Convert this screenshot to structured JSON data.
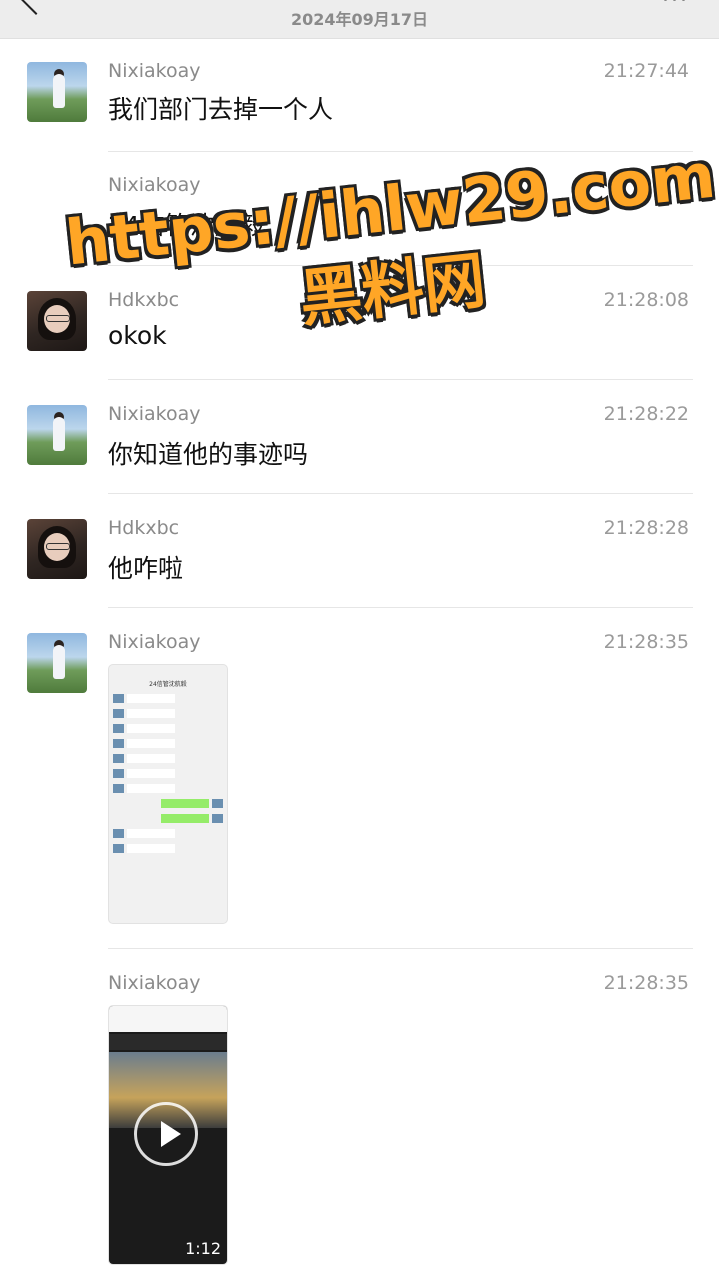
{
  "header": {
    "date": "2024年09月17日"
  },
  "messages": [
    {
      "sender": "Nixiakoay",
      "time": "21:27:44",
      "text": "我们部门去掉一个人"
    },
    {
      "sender": "Nixiakoay",
      "time": "",
      "text": "24信管沈航毅"
    },
    {
      "sender": "Hdkxbc",
      "time": "21:28:08",
      "text": "okok"
    },
    {
      "sender": "Nixiakoay",
      "time": "21:28:22",
      "text": "你知道他的事迹吗"
    },
    {
      "sender": "Hdkxbc",
      "time": "21:28:28",
      "text": "他咋啦"
    },
    {
      "sender": "Nixiakoay",
      "time": "21:28:35",
      "image_title": "24信管沈航毅"
    },
    {
      "sender": "Nixiakoay",
      "time": "21:28:35",
      "video_duration": "1:12"
    }
  ],
  "watermark": {
    "url": "https://ihlw29.com",
    "site": "黑料网"
  },
  "colors": {
    "accent": "#ffa626",
    "bubble_green": "#95ec69"
  }
}
